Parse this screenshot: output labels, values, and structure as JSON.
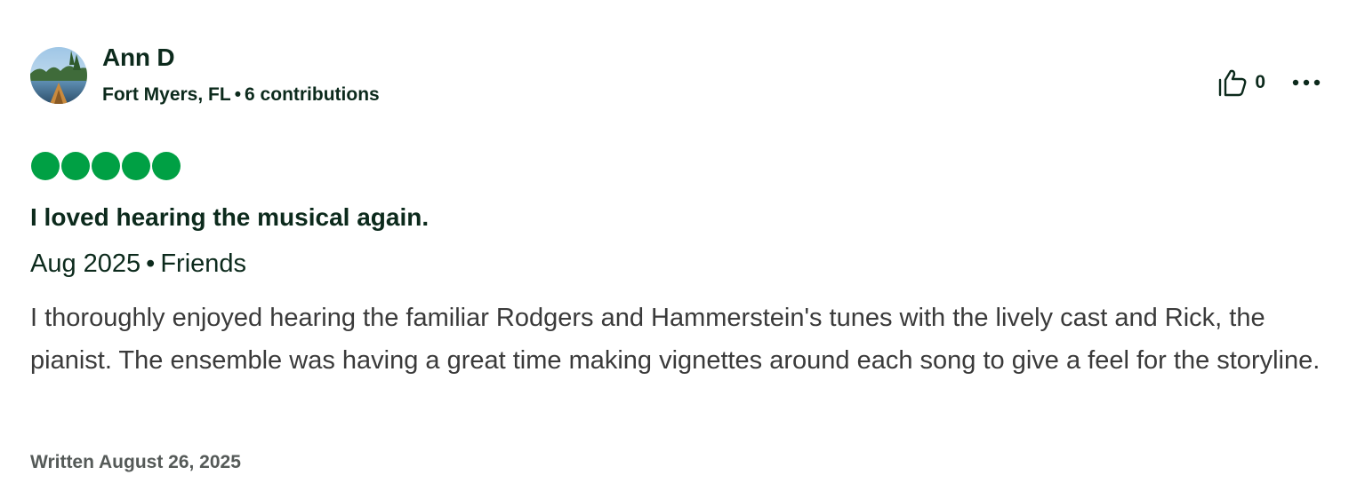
{
  "author": {
    "name": "Ann D",
    "location": "Fort Myers, FL",
    "separator": "•",
    "contributions": "6 contributions",
    "avatar_icon": "user-avatar-lake-photo"
  },
  "actions": {
    "vote_icon": "thumbs-up-icon",
    "vote_count": "0",
    "more_icon": "more-options-icon"
  },
  "rating": {
    "value": 5,
    "max": 5,
    "color": "#00a044"
  },
  "review": {
    "title": "I loved hearing the musical again.",
    "date": "Aug 2025",
    "separator": "•",
    "trip_type": "Friends",
    "body": "I thoroughly enjoyed hearing the familiar Rodgers and Hammerstein's tunes with the lively cast and Rick, the pianist. The ensemble was having a great time making vignettes around each song to give a feel for the storyline.",
    "written": "Written August 26, 2025"
  },
  "colors": {
    "text_dark": "#0c2a1c",
    "body_text": "#3a3a3a",
    "muted": "#555a58",
    "accent_green": "#00a044"
  }
}
